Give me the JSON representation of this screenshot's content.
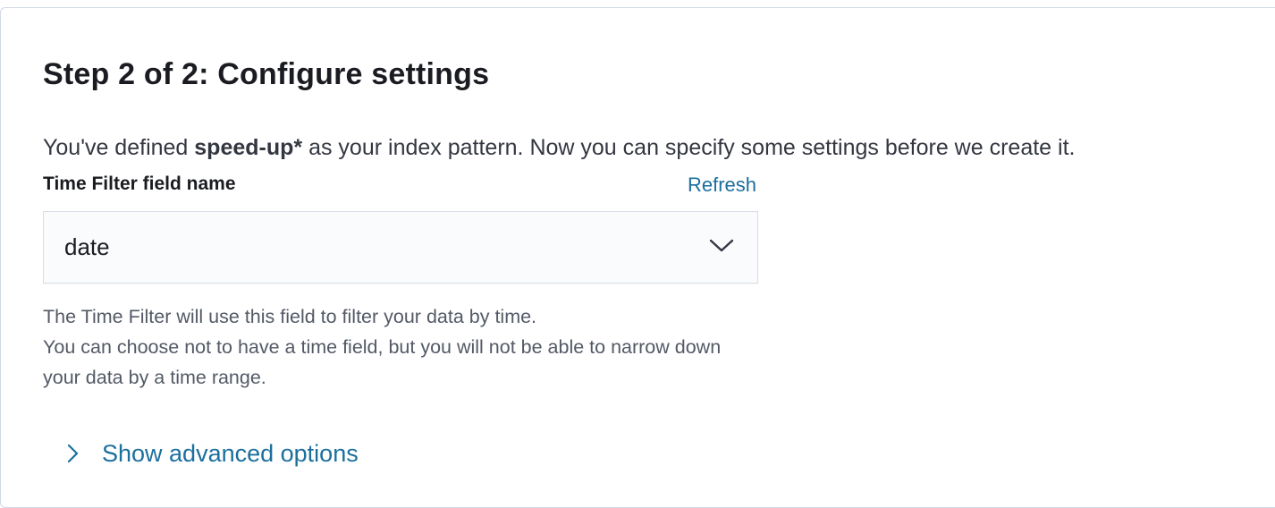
{
  "step": {
    "title": "Step 2 of 2: Configure settings"
  },
  "intro": {
    "prefix": "You've defined ",
    "pattern": "speed-up*",
    "suffix": " as your index pattern. Now you can specify some settings before we create it."
  },
  "time_field": {
    "label": "Time Filter field name",
    "refresh_label": "Refresh",
    "selected_value": "date",
    "help_line_1": "The Time Filter will use this field to filter your data by time.",
    "help_line_2": "You can choose not to have a time field, but you will not be able to narrow down your data by a time range."
  },
  "advanced": {
    "label": "Show advanced options"
  },
  "icons": {
    "select": "chevron-down-icon",
    "advanced": "chevron-right-icon"
  },
  "colors": {
    "link": "#1b6f9e",
    "title": "#1a1c21",
    "help_text": "#535966",
    "select_bg": "#fafbfd",
    "panel_border": "#d3dae6"
  }
}
